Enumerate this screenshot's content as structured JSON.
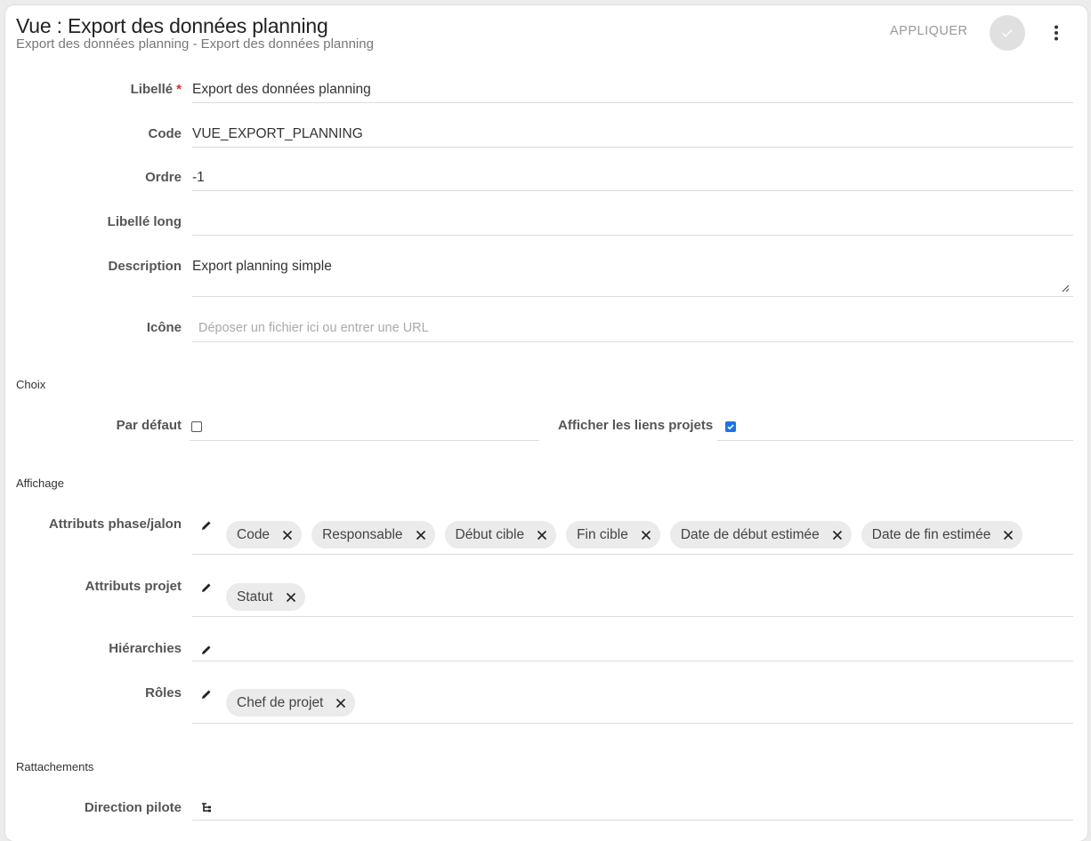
{
  "header": {
    "title": "Vue : Export des données planning",
    "subtitle": "Export des données planning - Export des données planning",
    "apply_label": "APPLIQUER"
  },
  "fields": {
    "libelle": {
      "label": "Libellé",
      "required_mark": "*",
      "value": "Export des données planning"
    },
    "code": {
      "label": "Code",
      "value": "VUE_EXPORT_PLANNING"
    },
    "ordre": {
      "label": "Ordre",
      "value": "-1"
    },
    "libelle_long": {
      "label": "Libellé long",
      "value": ""
    },
    "description": {
      "label": "Description",
      "value": "Export planning simple"
    },
    "icone": {
      "label": "Icône",
      "placeholder": "Déposer un fichier ici ou entrer une URL"
    }
  },
  "sections": {
    "choix": "Choix",
    "affichage": "Affichage",
    "rattachements": "Rattachements"
  },
  "choix": {
    "par_defaut": {
      "label": "Par défaut",
      "checked": false
    },
    "afficher_liens": {
      "label": "Afficher les liens projets",
      "checked": true
    }
  },
  "affichage": {
    "attributs_phase": {
      "label": "Attributs phase/jalon",
      "chips": [
        "Code",
        "Responsable",
        "Début cible",
        "Fin cible",
        "Date de début estimée",
        "Date de fin estimée"
      ]
    },
    "attributs_projet": {
      "label": "Attributs projet",
      "chips": [
        "Statut"
      ]
    },
    "hierarchies": {
      "label": "Hiérarchies",
      "chips": []
    },
    "roles": {
      "label": "Rôles",
      "chips": [
        "Chef de projet"
      ]
    }
  },
  "rattachements": {
    "direction_pilote": {
      "label": "Direction pilote"
    }
  },
  "colors": {
    "accent": "#1a73e8",
    "required": "#d32f2f",
    "chip_bg": "#ebebeb"
  },
  "icons": [
    "check-icon",
    "more-vert-icon",
    "pencil-icon",
    "close-icon",
    "tree-icon",
    "resize-icon"
  ]
}
